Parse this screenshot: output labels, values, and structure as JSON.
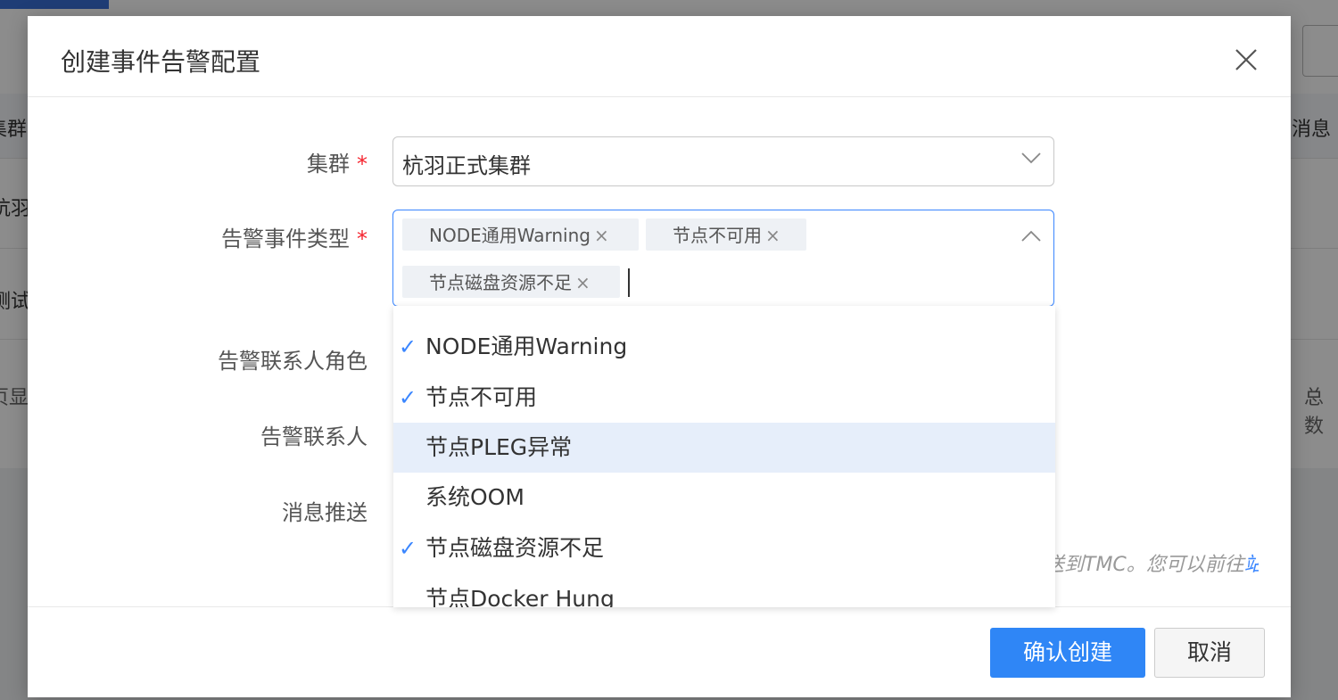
{
  "background": {
    "col_cluster": "集群",
    "col_message": "消息",
    "row1_cluster": "杭羽",
    "row2_cluster": "测试",
    "pager_left": "页显",
    "pager_right": "总数"
  },
  "modal": {
    "title": "创建事件告警配置",
    "fields": {
      "cluster_label": "集群",
      "event_type_label": "告警事件类型",
      "contact_role_label": "告警联系人角色",
      "contact_label": "告警联系人",
      "push_label": "消息推送",
      "required_mark": "*"
    },
    "cluster_select": {
      "value": "杭羽正式集群"
    },
    "event_type_select": {
      "tags": [
        {
          "label": "NODE通用Warning"
        },
        {
          "label": "节点不可用"
        },
        {
          "label": "节点磁盘资源不足"
        }
      ],
      "tag_remove": "×"
    },
    "dropdown_options": [
      {
        "label": "NODE通用Warning",
        "checked": true
      },
      {
        "label": "节点不可用",
        "checked": true
      },
      {
        "label": "节点PLEG异常",
        "checked": false,
        "hovered": true
      },
      {
        "label": "系统OOM",
        "checked": false
      },
      {
        "label": "节点磁盘资源不足",
        "checked": true
      },
      {
        "label": "节点Docker Hung",
        "checked": false
      }
    ],
    "check_mark": "✓",
    "help_text_visible": "送到TMC。您可以前往",
    "help_link": "站",
    "buttons": {
      "confirm": "确认创建",
      "cancel": "取消"
    }
  },
  "colors": {
    "primary": "#2f86f6",
    "required": "#f5222d",
    "hover_bg": "#e6eefa"
  }
}
